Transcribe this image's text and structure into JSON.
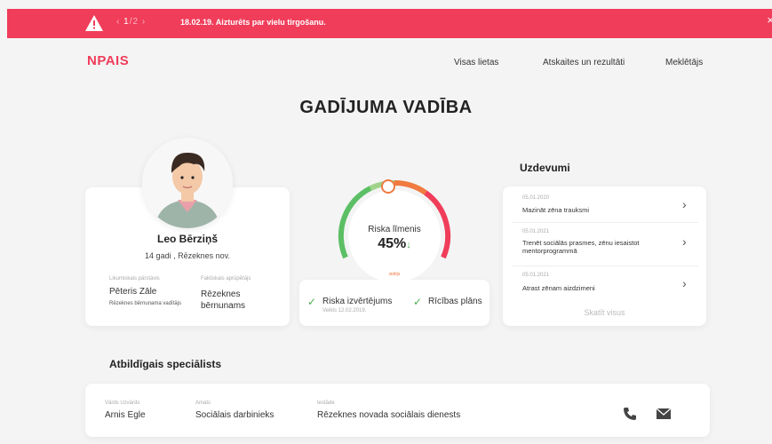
{
  "alert": {
    "pager_prev": "‹",
    "pager_current": "1",
    "pager_sep": "/",
    "pager_total": "2",
    "pager_next": "›",
    "text": "18.02.19. Aizturēts par vielu tirgošanu.",
    "close": "×"
  },
  "brand": "NPAIS",
  "nav": {
    "items": [
      "Visas lietas",
      "Atskaites un rezultāti",
      "Meklētājs"
    ]
  },
  "page_title": "GADĪJUMA VADĪBA",
  "profile": {
    "name": "Leo Bērziņš",
    "subtitle": "14 gadi , Rēzeknes nov.",
    "guardian_label": "Likumiskais pārstāvis",
    "guardian_name": "Pēteris Zāle",
    "guardian_note": "Rēzeknes bērnunama vadītājs",
    "caretaker_label": "Faktiskais aprūpētājs",
    "caretaker_name": "Rēzeknes bērnunams"
  },
  "risk": {
    "label": "Riska līmenis",
    "value": "45%",
    "trend_icon": "↓",
    "level": "vidējs",
    "assessment_label": "Riska izvērtējums",
    "assessment_date": "Veikts 12.02.2019.",
    "plan_label": "Rīcības plāns",
    "gauge_percent": 45
  },
  "tasks": {
    "title": "Uzdevumi",
    "items": [
      {
        "date": "05.01.2020",
        "text": "Mazināt zēna trauksmi"
      },
      {
        "date": "05.01.2021",
        "text": "Trenēt sociālās prasmes, zēnu iesaistot mentorprogrammā"
      },
      {
        "date": "05.01.2021",
        "text": "Atrast zēnam aizdzimeni"
      }
    ],
    "more": "Skatīt visus"
  },
  "specialist": {
    "title": "Atbildīgais speciālists",
    "name_label": "Vārds Uzvārds",
    "name": "Arnis Egle",
    "role_label": "Amats",
    "role": "Sociālais darbinieks",
    "org_label": "Iestāde",
    "org": "Rēzeknes novada sociālais dienests"
  },
  "colors": {
    "accent": "#f03d5a",
    "gauge_green": "#5cbf65",
    "gauge_orange": "#f07a40",
    "gauge_red": "#f03d5a",
    "check": "#4caf50"
  },
  "icons": [
    "warning-icon",
    "phone-icon",
    "mail-icon",
    "chevron-right-icon",
    "check-icon"
  ]
}
